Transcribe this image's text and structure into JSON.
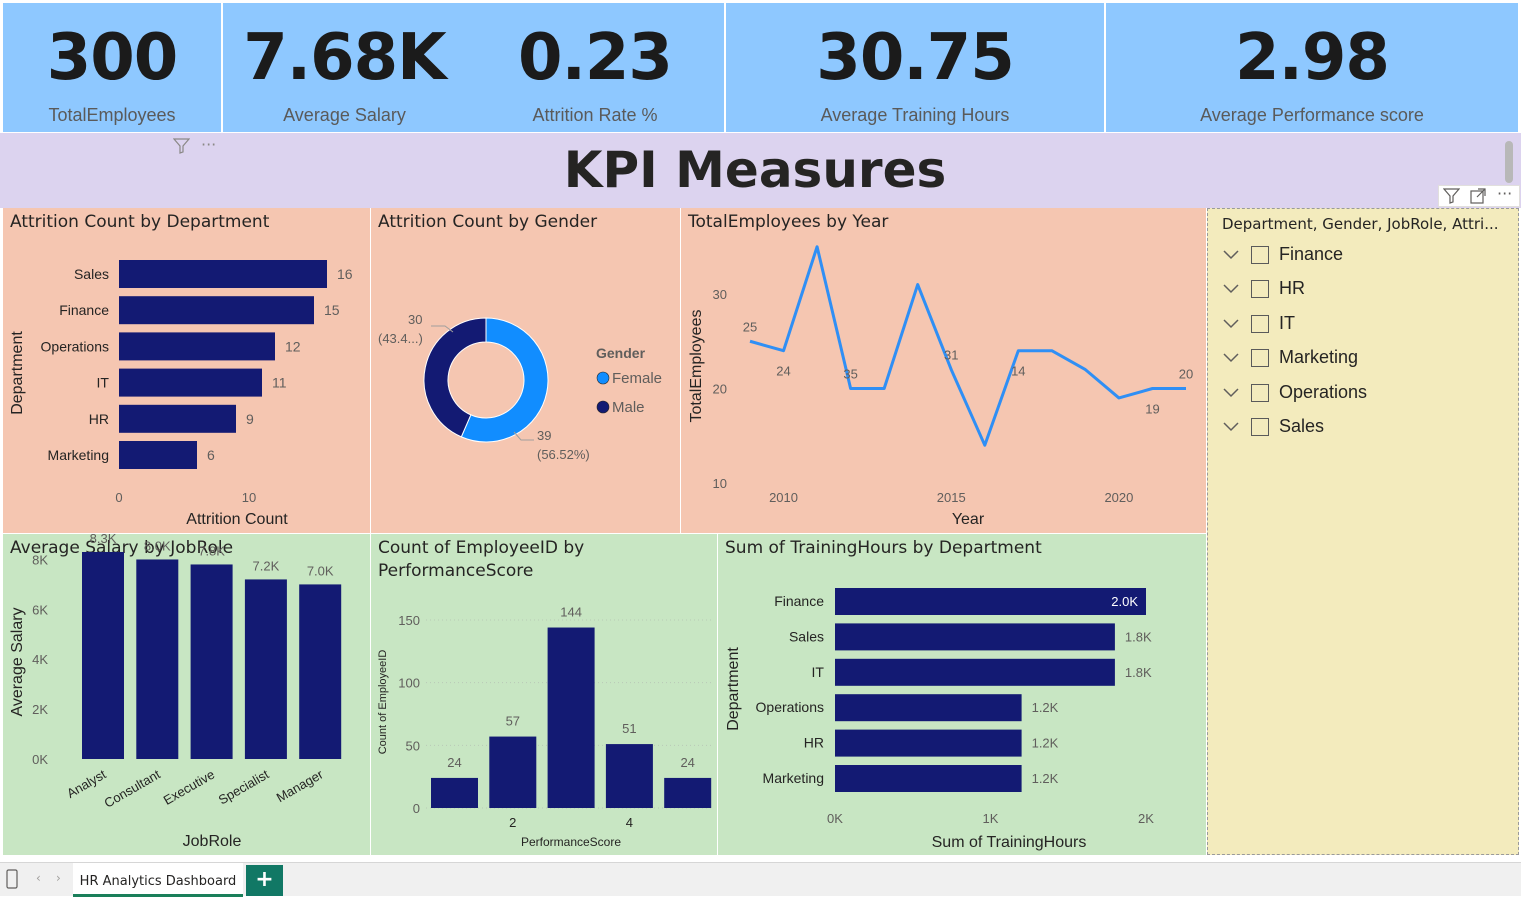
{
  "kpis": [
    {
      "value": "300",
      "label": "TotalEmployees"
    },
    {
      "value": "7.68K",
      "label": "Average Salary"
    },
    {
      "value": "0.23",
      "label": "Attrition Rate %"
    },
    {
      "value": "30.75",
      "label": "Average Training Hours"
    },
    {
      "value": "2.98",
      "label": "Average Performance score"
    }
  ],
  "page_title": "KPI Measures",
  "colors": {
    "bar": "#131a73",
    "line": "#2f8ff5",
    "female": "#118dff",
    "male": "#131a73",
    "kpi_bg": "#8ec8ff",
    "peach": "#f5c6b1",
    "green": "#c8e6c3",
    "slicer_bg": "#f3ebbd"
  },
  "visuals": {
    "attrition_dept": {
      "title": "Attrition Count by Department",
      "xlabel": "Attrition Count",
      "ylabel": "Department"
    },
    "attrition_gender": {
      "title": "Attrition Count by Gender",
      "legend_title": "Gender"
    },
    "employees_year": {
      "title": "TotalEmployees by Year",
      "xlabel": "Year",
      "ylabel": "TotalEmployees"
    },
    "salary_role": {
      "title": "Average Salary by JobRole",
      "xlabel": "JobRole",
      "ylabel": "Average Salary"
    },
    "perf_count": {
      "title_line1": "Count of EmployeeID by",
      "title_line2": "PerformanceScore",
      "xlabel": "PerformanceScore",
      "ylabel": "Count of EmployeeID"
    },
    "training_dept": {
      "title": "Sum of TrainingHours by Department",
      "xlabel": "Sum of TrainingHours",
      "ylabel": "Department"
    }
  },
  "chart_data": [
    {
      "id": "attrition_dept",
      "type": "bar",
      "orientation": "horizontal",
      "categories": [
        "Sales",
        "Finance",
        "Operations",
        "IT",
        "HR",
        "Marketing"
      ],
      "values": [
        16,
        15,
        12,
        11,
        9,
        6
      ],
      "data_labels": [
        "16",
        "15",
        "12",
        "11",
        "9",
        "6"
      ],
      "x_ticks": [
        "0",
        "10"
      ],
      "xlim": [
        0,
        17
      ],
      "xlabel": "Attrition Count",
      "ylabel": "Department"
    },
    {
      "id": "attrition_gender",
      "type": "pie",
      "donut": true,
      "categories": [
        "Female",
        "Male"
      ],
      "values": [
        39,
        30
      ],
      "percent_labels": [
        "(56.52%)",
        "(43.4...)"
      ],
      "value_labels": [
        "39",
        "30"
      ],
      "legend": "right"
    },
    {
      "id": "employees_year",
      "type": "line",
      "x": [
        2009,
        2010,
        2011,
        2012,
        2013,
        2014,
        2015,
        2016,
        2017,
        2018,
        2019,
        2020,
        2021,
        2022
      ],
      "y": [
        25,
        24,
        35,
        20,
        20,
        31,
        22,
        14,
        24,
        24,
        22,
        19,
        20,
        20
      ],
      "point_labels": {
        "2009": "25",
        "2010": "24",
        "2012": "35",
        "2015": "31",
        "2017": "14",
        "2021": "19",
        "2022": "20"
      },
      "x_ticks": [
        "2010",
        "2015",
        "2020"
      ],
      "y_ticks": [
        "10",
        "20",
        "30"
      ],
      "ylim": [
        10,
        35
      ],
      "xlabel": "Year",
      "ylabel": "TotalEmployees"
    },
    {
      "id": "salary_role",
      "type": "bar",
      "categories": [
        "Analyst",
        "Consultant",
        "Executive",
        "Specialist",
        "Manager"
      ],
      "values": [
        8300,
        8000,
        7800,
        7200,
        7000
      ],
      "data_labels": [
        "8.3K",
        "8.0K",
        "7.8K",
        "7.2K",
        "7.0K"
      ],
      "y_ticks": [
        "0K",
        "2K",
        "4K",
        "6K",
        "8K"
      ],
      "ylim": [
        0,
        8500
      ],
      "xlabel": "JobRole",
      "ylabel": "Average Salary"
    },
    {
      "id": "perf_count",
      "type": "bar",
      "categories": [
        "1",
        "2",
        "3",
        "4",
        "5"
      ],
      "values": [
        24,
        57,
        144,
        51,
        24
      ],
      "data_labels": [
        "24",
        "57",
        "144",
        "51",
        "24"
      ],
      "x_ticks": [
        "2",
        "4"
      ],
      "y_ticks": [
        "0",
        "50",
        "100",
        "150"
      ],
      "ylim": [
        0,
        150
      ],
      "xlabel": "PerformanceScore",
      "ylabel": "Count of EmployeeID"
    },
    {
      "id": "training_dept",
      "type": "bar",
      "orientation": "horizontal",
      "categories": [
        "Finance",
        "Sales",
        "IT",
        "Operations",
        "HR",
        "Marketing"
      ],
      "values": [
        2000,
        1800,
        1800,
        1200,
        1200,
        1200
      ],
      "data_labels": [
        "2.0K",
        "1.8K",
        "1.8K",
        "1.2K",
        "1.2K",
        "1.2K"
      ],
      "x_ticks": [
        "0K",
        "1K",
        "2K"
      ],
      "xlim": [
        0,
        2000
      ],
      "xlabel": "Sum of TrainingHours",
      "ylabel": "Department"
    }
  ],
  "slicer": {
    "header": "Department, Gender, JobRole, Attri...",
    "items": [
      "Finance",
      "HR",
      "IT",
      "Marketing",
      "Operations",
      "Sales"
    ]
  },
  "tabs": {
    "active": "HR Analytics Dashboard",
    "add": "+"
  }
}
